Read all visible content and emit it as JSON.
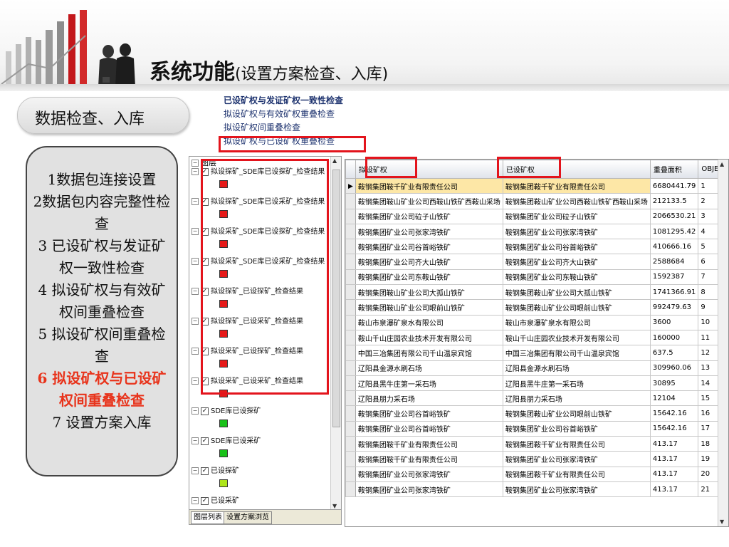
{
  "header": {
    "title": "系统功能",
    "title_sub": "(设置方案检查、入库)"
  },
  "section_label": "数据检查、入库",
  "steps": [
    {
      "text": "1数据包连接设置",
      "active": false
    },
    {
      "text": "2数据包内容完整性检查",
      "active": false
    },
    {
      "text": "3 已设矿权与发证矿权一致性检查",
      "active": false
    },
    {
      "text": "4 拟设矿权与有效矿权间重叠检查",
      "active": false
    },
    {
      "text": "5 拟设矿权间重叠检查",
      "active": false
    },
    {
      "text": "6 拟设矿权与已设矿权间重叠检查",
      "active": true
    },
    {
      "text": "7 设置方案入库",
      "active": false
    }
  ],
  "menu_links": [
    "已设矿权与发证矿权一致性检查",
    "拟设矿权与有效矿权重叠检查",
    "拟设矿权间重叠检查",
    "拟设矿权与已设矿权重叠检查"
  ],
  "layers": {
    "root": "图层",
    "items": [
      {
        "label": "拟设探矿_SDE库已设探矿_检查结果",
        "swatch": "#e61919"
      },
      {
        "label": "拟设探矿_SDE库已设采矿_检查结果",
        "swatch": "#e61919"
      },
      {
        "label": "拟设采矿_SDE库已设探矿_检查结果",
        "swatch": "#e61919"
      },
      {
        "label": "拟设采矿_SDE库已设采矿_检查结果",
        "swatch": "#e61919"
      },
      {
        "label": "拟设探矿_已设探矿_检查结果",
        "swatch": "#e61919"
      },
      {
        "label": "拟设探矿_已设采矿_检查结果",
        "swatch": "#e61919"
      },
      {
        "label": "拟设采矿_已设探矿_检查结果",
        "swatch": "#e61919"
      },
      {
        "label": "拟设采矿_已设采矿_检查结果",
        "swatch": "#e61919"
      },
      {
        "label": "SDE库已设探矿",
        "swatch": "#19c219"
      },
      {
        "label": "SDE库已设采矿",
        "swatch": "#19c219"
      },
      {
        "label": "已设探矿",
        "swatch": "#aee61a"
      },
      {
        "label": "已设采矿",
        "swatch": "#19c219"
      }
    ],
    "tabs": [
      "图层列表",
      "设置方案浏览"
    ]
  },
  "table": {
    "columns": [
      "拟设矿权",
      "已设矿权",
      "重叠面积",
      "OBJECTID"
    ],
    "rows": [
      [
        "鞍钢集团鞍千矿业有限责任公司",
        "鞍钢集团鞍千矿业有限责任公司",
        "6680441.79",
        "1"
      ],
      [
        "鞍钢集团鞍山矿业公司西鞍山铁矿西鞍山采场",
        "鞍钢集团鞍山矿业公司西鞍山铁矿西鞍山采场",
        "212133.5",
        "2"
      ],
      [
        "鞍钢集团矿业公司砬子山铁矿",
        "鞍钢集团矿业公司砬子山铁矿",
        "2066530.21",
        "3"
      ],
      [
        "鞍钢集团矿业公司张家湾铁矿",
        "鞍钢集团矿业公司张家湾铁矿",
        "1081295.42",
        "4"
      ],
      [
        "鞍钢集团矿业公司谷首峪铁矿",
        "鞍钢集团矿业公司谷首峪铁矿",
        "410666.16",
        "5"
      ],
      [
        "鞍钢集团矿业公司齐大山铁矿",
        "鞍钢集团矿业公司齐大山铁矿",
        "2588684",
        "6"
      ],
      [
        "鞍钢集团矿业公司东鞍山铁矿",
        "鞍钢集团矿业公司东鞍山铁矿",
        "1592387",
        "7"
      ],
      [
        "鞍钢集团鞍山矿业公司大孤山铁矿",
        "鞍钢集团鞍山矿业公司大孤山铁矿",
        "1741366.91",
        "8"
      ],
      [
        "鞍钢集团鞍山矿业公司眼前山铁矿",
        "鞍钢集团鞍山矿业公司眼前山铁矿",
        "992479.63",
        "9"
      ],
      [
        "鞍山市泉瀑矿泉水有限公司",
        "鞍山市泉瀑矿泉水有限公司",
        "3600",
        "10"
      ],
      [
        "鞍山千山庄园农业技术开发有限公司",
        "鞍山千山庄园农业技术开发有限公司",
        "160000",
        "11"
      ],
      [
        "中国三冶集团有限公司千山温泉宾馆",
        "中国三冶集团有限公司千山温泉宾馆",
        "637.5",
        "12"
      ],
      [
        "辽阳县金源水刷石场",
        "辽阳县金源水刷石场",
        "309960.06",
        "13"
      ],
      [
        "辽阳县黑牛庄第一采石场",
        "辽阳县黑牛庄第一采石场",
        "30895",
        "14"
      ],
      [
        "辽阳县朋力采石场",
        "辽阳县朋力采石场",
        "12104",
        "15"
      ],
      [
        "鞍钢集团矿业公司谷首峪铁矿",
        "鞍钢集团鞍山矿业公司眼前山铁矿",
        "15642.16",
        "16"
      ],
      [
        "鞍钢集团矿业公司谷首峪铁矿",
        "鞍钢集团矿业公司谷首峪铁矿",
        "15642.16",
        "17"
      ],
      [
        "鞍钢集团鞍千矿业有限责任公司",
        "鞍钢集团鞍千矿业有限责任公司",
        "413.17",
        "18"
      ],
      [
        "鞍钢集团鞍千矿业有限责任公司",
        "鞍钢集团矿业公司张家湾铁矿",
        "413.17",
        "19"
      ],
      [
        "鞍钢集团矿业公司张家湾铁矿",
        "鞍钢集团鞍千矿业有限责任公司",
        "413.17",
        "20"
      ],
      [
        "鞍钢集团矿业公司张家湾铁矿",
        "鞍钢集团矿业公司张家湾铁矿",
        "413.17",
        "21"
      ]
    ]
  },
  "colors": {
    "highlight_red": "#e3141c",
    "active_step": "#e8341c",
    "link_blue": "#1f3470"
  }
}
